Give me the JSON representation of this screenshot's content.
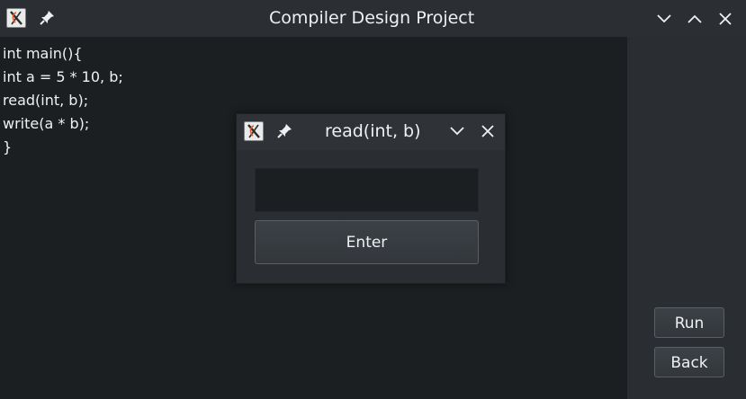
{
  "window": {
    "title": "Compiler Design Project"
  },
  "editor": {
    "lines": [
      "int main(){",
      "int a = 5 * 10, b;",
      "read(int, b);",
      "write(a * b);",
      "}"
    ]
  },
  "side_panel": {
    "run_label": "Run",
    "back_label": "Back"
  },
  "dialog": {
    "title": "read(int, b)",
    "input_value": "",
    "enter_label": "Enter"
  },
  "icons": {
    "app": "app-x-icon",
    "pin": "pin-icon",
    "minimize": "chevron-down-icon",
    "maximize": "chevron-up-icon",
    "close": "close-icon"
  },
  "colors": {
    "titlebar": "#2b2f33",
    "editor_bg": "#1c1f22",
    "text": "#eff0f1",
    "icon_accent": "#e0592a"
  }
}
